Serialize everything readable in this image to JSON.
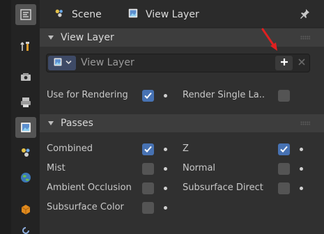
{
  "header": {
    "scene_label": "Scene",
    "view_layer_label": "View Layer",
    "icons": [
      "properties-editor-icon",
      "scene-icon",
      "view-layer-icon",
      "pin-icon"
    ]
  },
  "sidebar": {
    "tabs": [
      {
        "name": "tool-tab",
        "icon": "tool-icon",
        "active": false
      },
      {
        "name": "render-tab",
        "icon": "render-icon",
        "active": false
      },
      {
        "name": "output-tab",
        "icon": "output-icon",
        "active": false
      },
      {
        "name": "view-layer-tab",
        "icon": "view-layer-icon",
        "active": true
      },
      {
        "name": "scene-tab",
        "icon": "scene-icon",
        "active": false
      },
      {
        "name": "world-tab",
        "icon": "world-icon",
        "active": false
      },
      {
        "name": "object-tab",
        "icon": "object-icon",
        "active": false
      },
      {
        "name": "modifier-tab",
        "icon": "modifier-icon",
        "active": false
      }
    ]
  },
  "view_layer_panel": {
    "title": "View Layer",
    "selector_value": "View Layer",
    "use_for_rendering": {
      "label": "Use for Rendering",
      "checked": true
    },
    "render_single_layer": {
      "label": "Render Single La..",
      "checked": false
    }
  },
  "passes_panel": {
    "title": "Passes",
    "items": [
      {
        "label": "Combined",
        "checked": true
      },
      {
        "label": "Z",
        "checked": true
      },
      {
        "label": "Mist",
        "checked": false
      },
      {
        "label": "Normal",
        "checked": false
      },
      {
        "label": "Ambient Occlusion",
        "checked": false
      },
      {
        "label": "Subsurface Direct",
        "checked": false
      },
      {
        "label": "Subsurface Color",
        "checked": false
      }
    ]
  },
  "colors": {
    "accent": "#4772b3",
    "annotation_arrow": "#e02020",
    "panel_header": "#3d3d3d",
    "background": "#303030"
  }
}
